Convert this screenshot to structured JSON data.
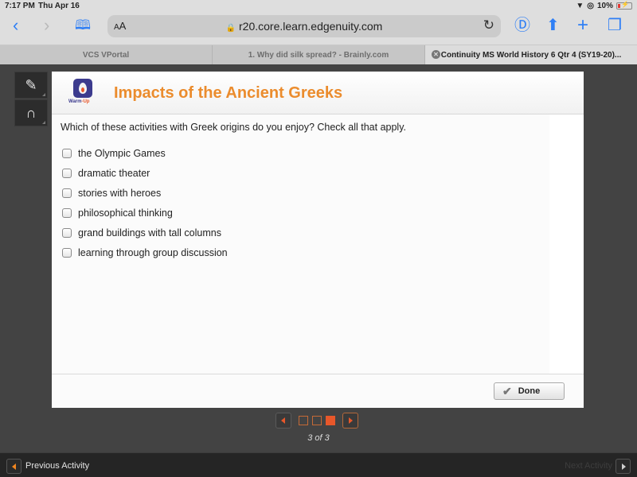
{
  "status_bar": {
    "time": "7:17 PM",
    "date": "Thu Apr 16",
    "battery": "10%"
  },
  "browser": {
    "text_size_label": "AA",
    "url": "r20.core.learn.edgenuity.com",
    "tabs": [
      {
        "label": "VCS VPortal",
        "active": false
      },
      {
        "label": "1. Why did silk spread? - Brainly.com",
        "active": false
      },
      {
        "label": "Continuity MS World History 6 Qtr 4 (SY19-20)...",
        "active": true
      }
    ]
  },
  "activity": {
    "badge_label_part1": "Warm",
    "badge_label_part2": "-Up",
    "title": "Impacts of the Ancient Greeks",
    "question": "Which of these activities with Greek origins do you enjoy? Check all that apply.",
    "options": [
      {
        "label": "the Olympic Games",
        "checked": false
      },
      {
        "label": "dramatic theater",
        "checked": false
      },
      {
        "label": "stories with heroes",
        "checked": false
      },
      {
        "label": "philosophical thinking",
        "checked": false
      },
      {
        "label": "grand buildings with tall columns",
        "checked": false
      },
      {
        "label": "learning through group discussion",
        "checked": false
      }
    ],
    "done_label": "Done"
  },
  "pager": {
    "current": 3,
    "total": 3,
    "label": "3 of 3"
  },
  "bottom_bar": {
    "prev_label": "Previous Activity",
    "next_label": "Next Activity"
  },
  "colors": {
    "title_orange": "#eb8c2d",
    "accent_orange": "#e8572a",
    "badge_purple": "#3c3b8e",
    "safari_blue": "#2f7ff5"
  }
}
